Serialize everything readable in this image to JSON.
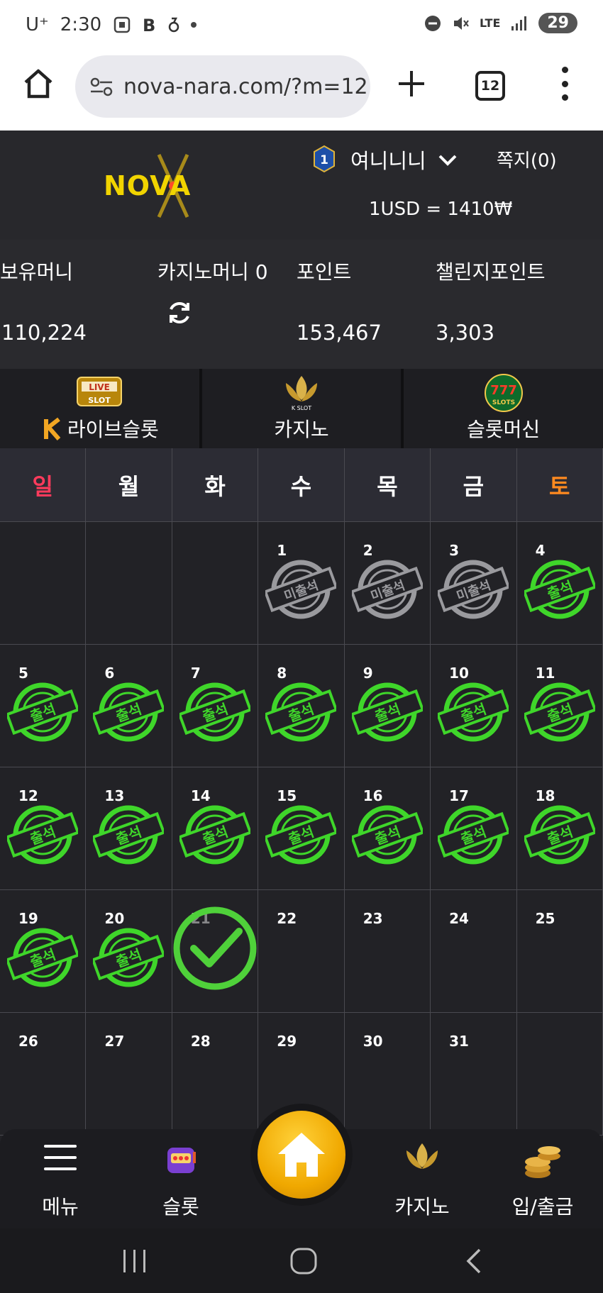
{
  "status_bar": {
    "carrier": "U⁺",
    "time": "2:30",
    "network": "LTE",
    "battery": "29"
  },
  "browser": {
    "url": "nova-nara.com/?m=12",
    "tab_count": "12"
  },
  "header": {
    "logo": "NOVA",
    "level": "1",
    "username": "여니니니",
    "message_label": "쪽지(0)",
    "exchange_rate": "1USD = 1410₩"
  },
  "balances": {
    "money_label": "보유머니",
    "money_value": "110,224",
    "casino_money_label": "카지노머니 0",
    "points_label": "포인트",
    "points_value": "153,467",
    "challenge_label": "챌린지포인트",
    "challenge_value": "3,303"
  },
  "categories": {
    "live_slot_icon_text": "LIVE SLOT",
    "live_slot": "라이브슬롯",
    "casino_icon_text": "K SLOT",
    "casino": "카지노",
    "slot_machine_icon_text": "777 SLOTS",
    "slot_machine": "슬롯머신"
  },
  "calendar": {
    "weekdays": [
      "일",
      "월",
      "화",
      "수",
      "목",
      "금",
      "토"
    ],
    "stamp_absent": "미출석",
    "stamp_present": "출석",
    "cells": [
      {
        "day": "",
        "status": "none"
      },
      {
        "day": "",
        "status": "none"
      },
      {
        "day": "",
        "status": "none"
      },
      {
        "day": "1",
        "status": "absent"
      },
      {
        "day": "2",
        "status": "absent"
      },
      {
        "day": "3",
        "status": "absent"
      },
      {
        "day": "4",
        "status": "present"
      },
      {
        "day": "5",
        "status": "present"
      },
      {
        "day": "6",
        "status": "present"
      },
      {
        "day": "7",
        "status": "present"
      },
      {
        "day": "8",
        "status": "present"
      },
      {
        "day": "9",
        "status": "present"
      },
      {
        "day": "10",
        "status": "present"
      },
      {
        "day": "11",
        "status": "present"
      },
      {
        "day": "12",
        "status": "present"
      },
      {
        "day": "13",
        "status": "present"
      },
      {
        "day": "14",
        "status": "present"
      },
      {
        "day": "15",
        "status": "present"
      },
      {
        "day": "16",
        "status": "present"
      },
      {
        "day": "17",
        "status": "present"
      },
      {
        "day": "18",
        "status": "present"
      },
      {
        "day": "19",
        "status": "present"
      },
      {
        "day": "20",
        "status": "present"
      },
      {
        "day": "21",
        "status": "today"
      },
      {
        "day": "22",
        "status": "none"
      },
      {
        "day": "23",
        "status": "none"
      },
      {
        "day": "24",
        "status": "none"
      },
      {
        "day": "25",
        "status": "none"
      },
      {
        "day": "26",
        "status": "none"
      },
      {
        "day": "27",
        "status": "none"
      },
      {
        "day": "28",
        "status": "none"
      },
      {
        "day": "29",
        "status": "none"
      },
      {
        "day": "30",
        "status": "none"
      },
      {
        "day": "31",
        "status": "none"
      },
      {
        "day": "",
        "status": "none"
      }
    ]
  },
  "bottom_nav": {
    "menu": "메뉴",
    "slot": "슬롯",
    "casino": "카지노",
    "deposit": "입/출금"
  },
  "colors": {
    "sunday": "#ff3b5c",
    "saturday": "#ff8a1f",
    "stamp_green": "#3fd62a",
    "stamp_gray": "#9a9a9e",
    "home_gold": "#f0a800"
  }
}
